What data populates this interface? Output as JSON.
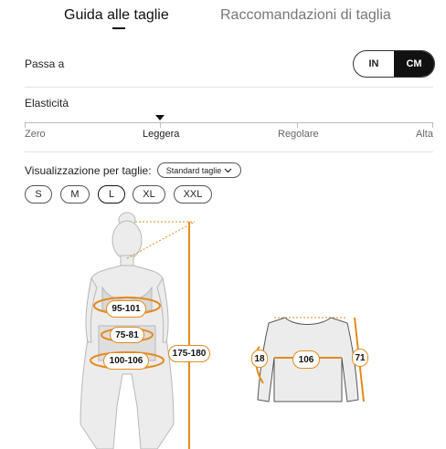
{
  "tabs": {
    "guide": "Guida alle taglie",
    "recommend": "Raccomandazioni di taglia"
  },
  "units": {
    "label": "Passa a",
    "in": "IN",
    "cm": "CM",
    "selected": "CM"
  },
  "elasticity": {
    "label": "Elasticità",
    "levels": [
      "Zero",
      "Leggera",
      "Regolare",
      "Alta"
    ],
    "selected": "Leggera"
  },
  "view": {
    "label": "Visualizzazione per taglie:",
    "dropdown": "Standard taglie"
  },
  "sizes": [
    "S",
    "M",
    "L",
    "XL",
    "XXL"
  ],
  "selected_size": "L",
  "body": {
    "bust": "95-101",
    "waist": "75-81",
    "hips": "100-106",
    "height": "175-180"
  },
  "garment": {
    "sleeve": "18",
    "width": "106",
    "length": "71"
  },
  "colors": {
    "accent": "#e58a1c",
    "selected": "#111111"
  }
}
